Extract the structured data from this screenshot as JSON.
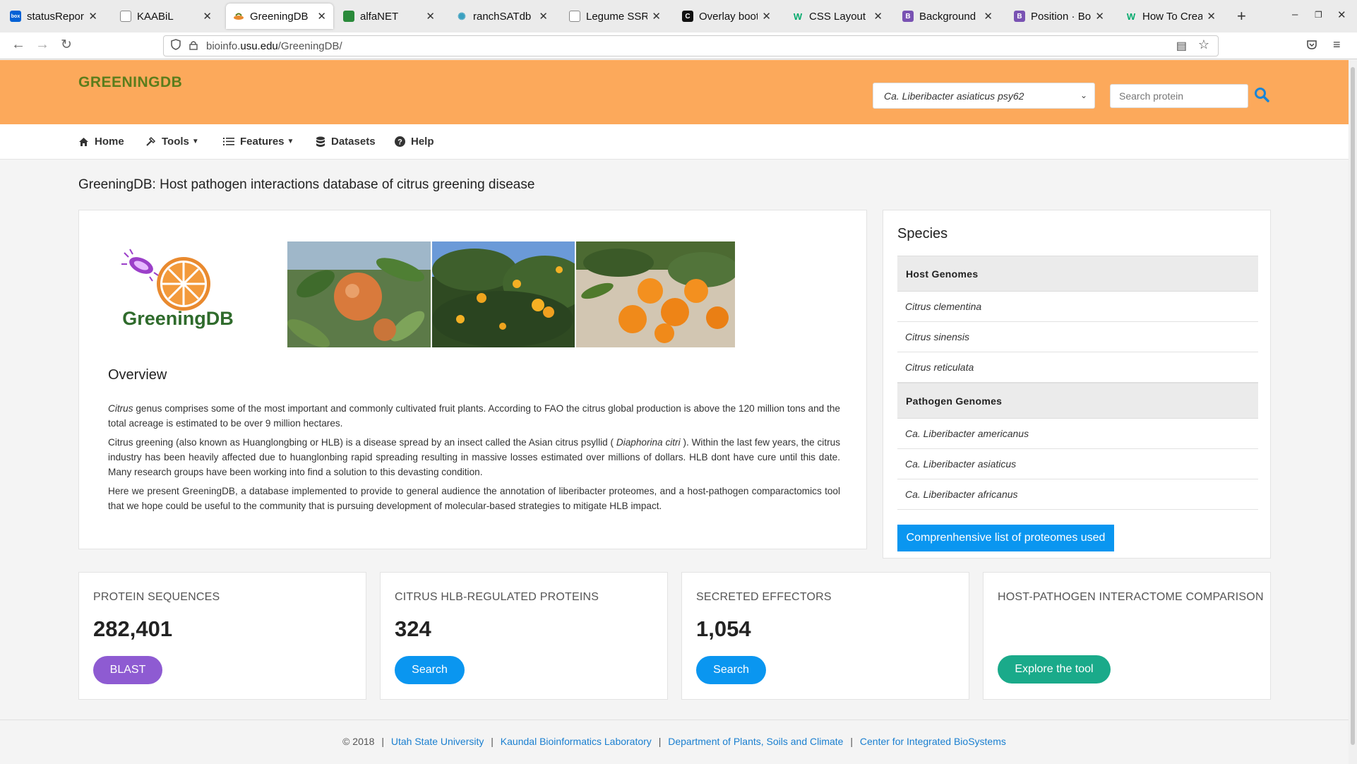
{
  "browser": {
    "tabs": [
      {
        "title": "statusReport.o",
        "favicon": "box",
        "color": "#0061d5",
        "active": false
      },
      {
        "title": "KAABiL",
        "favicon": "doc",
        "color": "#666",
        "active": false
      },
      {
        "title": "GreeningDB",
        "favicon": "leaf",
        "color": "#e98a2f",
        "active": true
      },
      {
        "title": "alfaNET",
        "favicon": "doc",
        "color": "#2a8a3a",
        "active": false
      },
      {
        "title": "ranchSATdb",
        "favicon": "react",
        "color": "#3aa0c0",
        "active": false
      },
      {
        "title": "Legume SSR Da",
        "favicon": "doc",
        "color": "#666",
        "active": false
      },
      {
        "title": "Overlay boots",
        "favicon": "C",
        "color": "#111",
        "active": false
      },
      {
        "title": "CSS Layout - Th",
        "favicon": "W",
        "color": "#04aa6d",
        "active": false
      },
      {
        "title": "Background · B",
        "favicon": "B",
        "color": "#7952b3",
        "active": false
      },
      {
        "title": "Position · Boot",
        "favicon": "B",
        "color": "#7952b3",
        "active": false
      },
      {
        "title": "How To Create",
        "favicon": "W",
        "color": "#04aa6d",
        "active": false
      }
    ],
    "url_prefix": "bioinfo.",
    "url_domain": "usu.edu",
    "url_path": "/GreeningDB/"
  },
  "header": {
    "brand": "GREENINGDB",
    "species_select": "Ca. Liberibacter asiaticus psy62",
    "search_placeholder": "Search protein"
  },
  "menu": {
    "home": "Home",
    "tools": "Tools",
    "features": "Features",
    "datasets": "Datasets",
    "help": "Help"
  },
  "page_title": "GreeningDB: Host pathogen interactions database of citrus greening disease",
  "overview": {
    "logo_text": "GreeningDB",
    "heading": "Overview",
    "p1_italic": "Citrus",
    "p1_rest": " genus comprises some of the most important and commonly cultivated fruit plants. According to FAO the citrus global production is above the 120 million tons and the total acreage is estimated to be over 9 million hectares.",
    "p2_start": "Citrus greening (also known as Huanglongbing or HLB) is a disease spread by an insect called the Asian citrus psyllid ( ",
    "p2_italic": "Diaphorina citri",
    "p2_end": " ). Within the last few years, the citrus industry has been heavily affected due to huanglonbing rapid spreading resulting in massive losses estimated over millions of dollars. HLB dont have cure until this date. Many research groups have been working into find a solution to this devasting condition.",
    "p3": "Here we present GreeningDB, a database implemented to provide to general audience the annotation of liberibacter proteomes, and a host-pathogen comparactomics tool that we hope could be useful to the community that is pursuing development of molecular-based strategies to mitigate HLB impact."
  },
  "species": {
    "heading": "Species",
    "host_label": "Host Genomes",
    "hosts": [
      "Citrus clementina",
      "Citrus sinensis",
      "Citrus reticulata"
    ],
    "pathogen_label": "Pathogen Genomes",
    "pathogens": [
      "Ca. Liberibacter americanus",
      "Ca. Liberibacter asiaticus",
      "Ca. Liberibacter africanus"
    ],
    "button": "Comprenhensive list of proteomes used"
  },
  "stats": [
    {
      "label": "PROTEIN SEQUENCES",
      "value": "282,401",
      "button": "BLAST",
      "color": "#8e5bd2"
    },
    {
      "label": "CITRUS HLB-REGULATED PROTEINS",
      "value": "324",
      "button": "Search",
      "color": "#0a96f0"
    },
    {
      "label": "SECRETED EFFECTORS",
      "value": "1,054",
      "button": "Search",
      "color": "#0a96f0"
    },
    {
      "label": "HOST-PATHOGEN INTERACTOME COMPARISON",
      "value": "",
      "button": "Explore the tool",
      "color": "#1aaa8a"
    }
  ],
  "footer": {
    "copyright": "© 2018",
    "links": [
      "Utah State University",
      "Kaundal Bioinformatics Laboratory",
      "Department of Plants, Soils and Climate",
      "Center for Integrated BioSystems"
    ]
  },
  "colors": {
    "header_bg": "#fca95b",
    "brand_green": "#5b7d1c",
    "primary_blue": "#0a96f0",
    "link_blue": "#1a7fd0"
  }
}
